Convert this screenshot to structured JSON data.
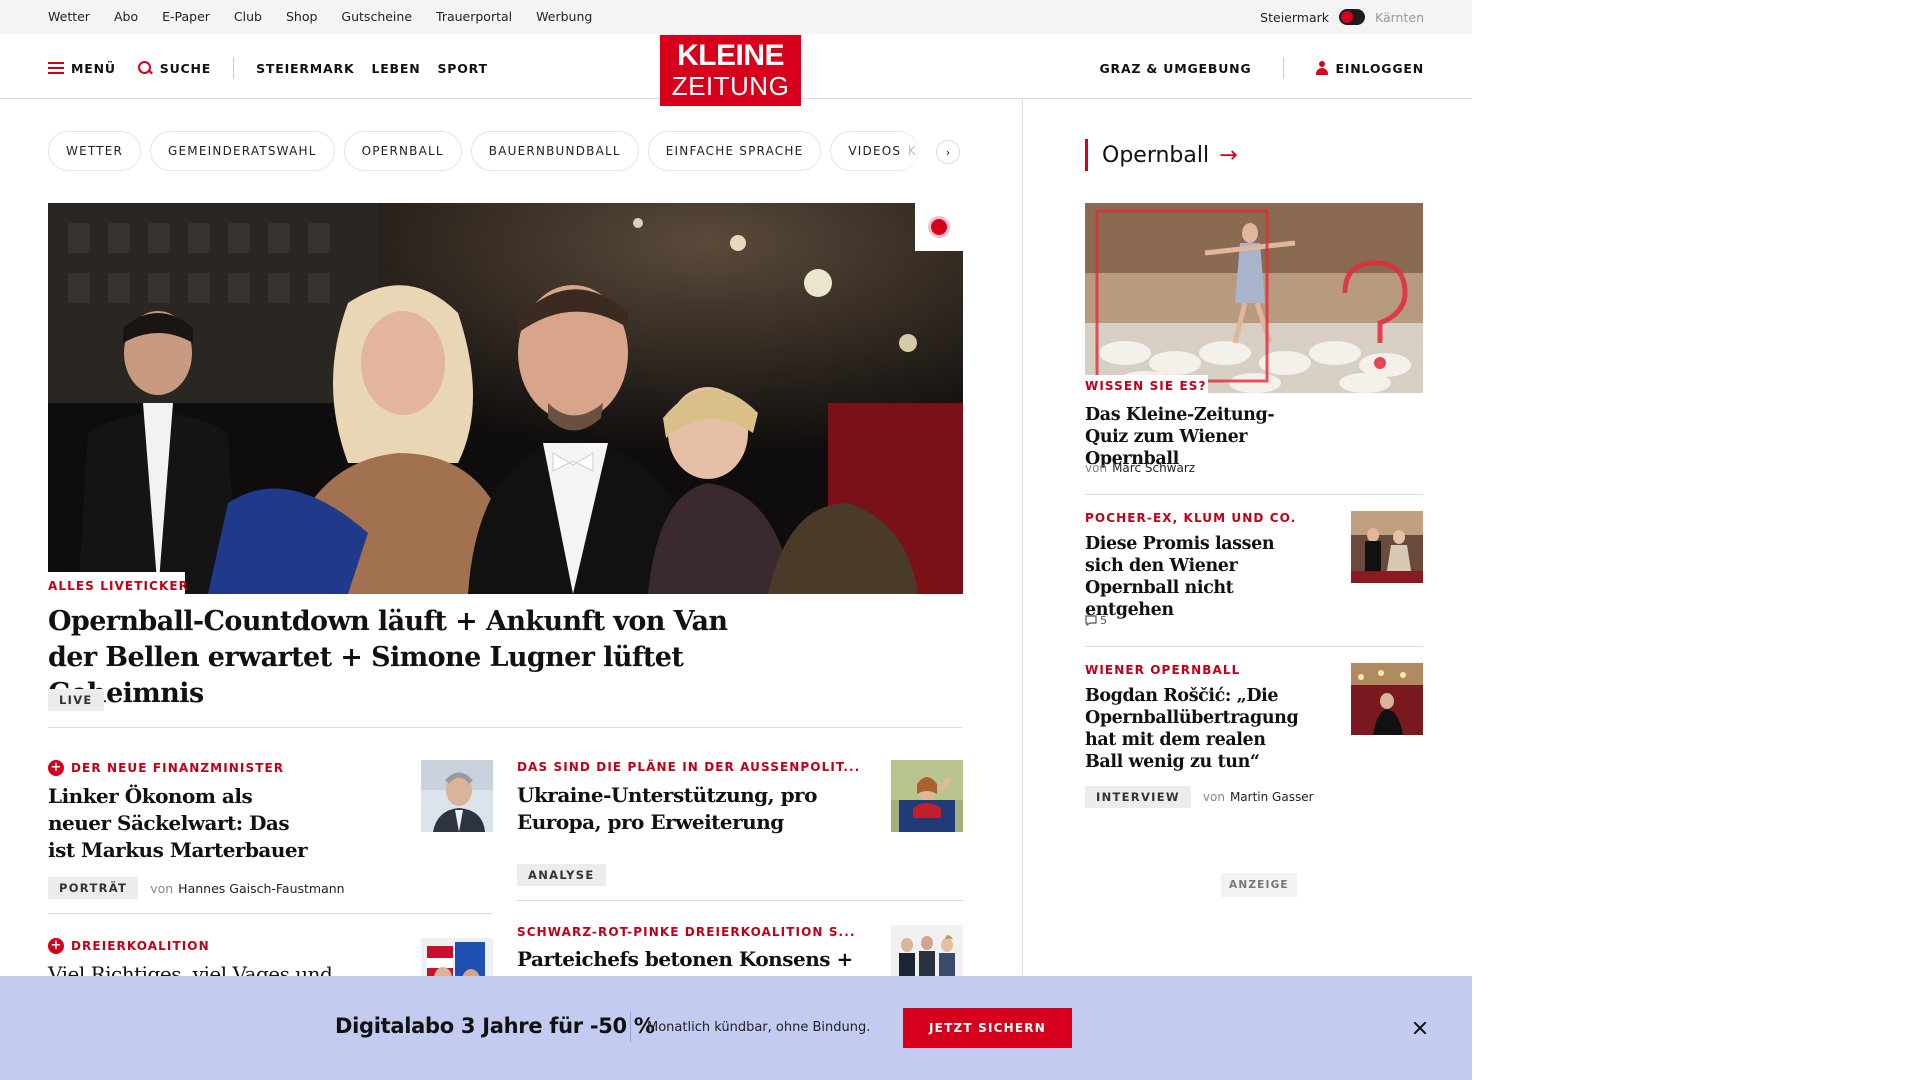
{
  "utility": {
    "links": [
      "Wetter",
      "Abo",
      "E-Paper",
      "Club",
      "Shop",
      "Gutscheine",
      "Trauerportal",
      "Werbung"
    ],
    "region_active": "Steiermark",
    "region_inactive": "Kärnten"
  },
  "header": {
    "menu_label": "MENÜ",
    "search_label": "SUCHE",
    "sections": [
      "STEIERMARK",
      "LEBEN",
      "SPORT"
    ],
    "logo_line1": "KLEINE",
    "logo_line2": "ZEITUNG",
    "region_link": "GRAZ & UMGEBUNG",
    "login_label": "EINLOGGEN"
  },
  "tags": [
    "WETTER",
    "GEMEINDERATSWAHL",
    "OPERNBALL",
    "BAUERNBUNDBALL",
    "EINFACHE SPRACHE",
    "VIDEOS"
  ],
  "tags_overflow": "K",
  "hero": {
    "kicker": "ALLES LIVETICKER",
    "title": "Opernball-Countdown läuft + Ankunft von Van der Bellen erwartet + Simone Lugner lüftet Geheimnis",
    "badge": "LIVE"
  },
  "teasers": [
    {
      "kicker": "DER NEUE FINANZMINISTER",
      "plus": true,
      "title": "Linker Ökonom als neuer Säckelwart: Das ist Markus Marterbauer",
      "badge": "PORTRÄT",
      "von": "von",
      "author": "Hannes Gaisch-Faustmann"
    },
    {
      "kicker": "DAS SIND DIE PLÄNE IN DER AUSSENPOLIT...",
      "plus": false,
      "title": "Ukraine-Unterstützung, pro Europa, pro Erweiterung",
      "badge": "ANALYSE"
    },
    {
      "kicker": "DREIERKOALITION",
      "plus": true,
      "title": "Viel Richtiges, viel Vages und"
    },
    {
      "kicker": "SCHWARZ-ROT-PINKE DREIERKOALITION S...",
      "plus": false,
      "title": "Parteichefs betonen Konsens +"
    }
  ],
  "sidebar": {
    "heading": "Opernball",
    "arrow_icon": "→",
    "items": [
      {
        "kicker": "WISSEN SIE ES?",
        "title": "Das Kleine-Zeitung-Quiz zum Wiener Opernball",
        "von": "von",
        "author": "Marc Schwarz"
      },
      {
        "kicker": "POCHER-EX, KLUM UND CO.",
        "title": "Diese Promis lassen sich den Wiener Opernball nicht entgehen",
        "comments": "5"
      },
      {
        "kicker": "WIENER OPERNBALL",
        "title": "Bogdan Roščić: „Die Opernballübertragung hat mit dem realen Ball wenig zu tun“",
        "badge": "INTERVIEW",
        "von": "von",
        "author": "Martin Gasser"
      }
    ],
    "ad_label": "ANZEIGE"
  },
  "banner": {
    "title": "Digitalabo 3 Jahre für -50 %",
    "subtitle": "Monatlich kündbar, ohne Bindung.",
    "cta": "JETZT SICHERN",
    "bg": "#c3cbf0"
  },
  "colors": {
    "brand_red": "#d6001c",
    "kicker_red": "#c00017"
  }
}
